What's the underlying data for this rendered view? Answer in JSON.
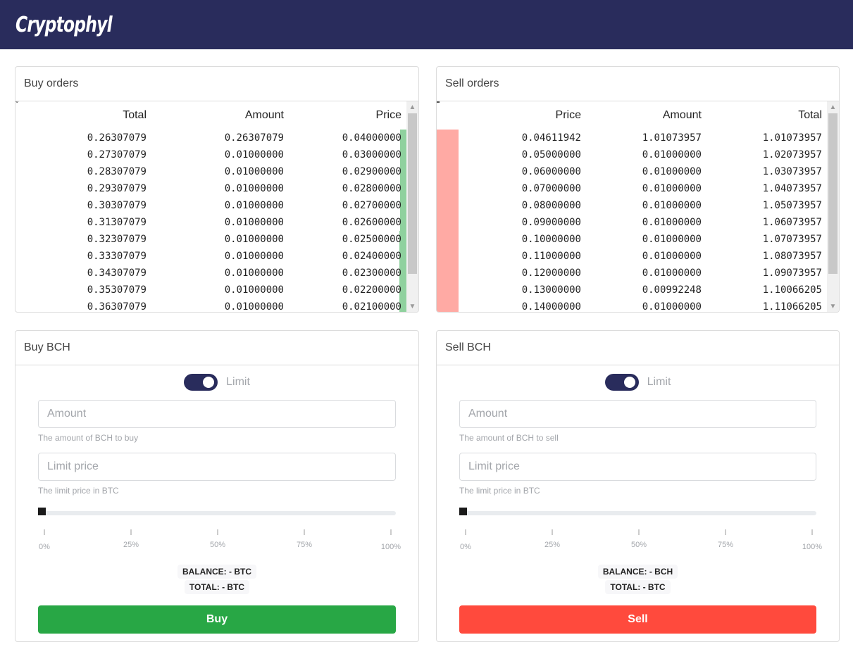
{
  "app": {
    "logo": "Cryptophyl"
  },
  "colors": {
    "header_bg": "#292c5c",
    "buy": "#28a745",
    "sell": "#ff4a3d",
    "buy_depth": "#8fd19e",
    "sell_depth": "#ffaaa4"
  },
  "buy_orders": {
    "title": "Buy orders",
    "columns": [
      "Total",
      "Amount",
      "Price"
    ],
    "rows": [
      {
        "total": "0.26307079",
        "amount": "0.26307079",
        "price": "0.04000000"
      },
      {
        "total": "0.27307079",
        "amount": "0.01000000",
        "price": "0.03000000"
      },
      {
        "total": "0.28307079",
        "amount": "0.01000000",
        "price": "0.02900000"
      },
      {
        "total": "0.29307079",
        "amount": "0.01000000",
        "price": "0.02800000"
      },
      {
        "total": "0.30307079",
        "amount": "0.01000000",
        "price": "0.02700000"
      },
      {
        "total": "0.31307079",
        "amount": "0.01000000",
        "price": "0.02600000"
      },
      {
        "total": "0.32307079",
        "amount": "0.01000000",
        "price": "0.02500000"
      },
      {
        "total": "0.33307079",
        "amount": "0.01000000",
        "price": "0.02400000"
      },
      {
        "total": "0.34307079",
        "amount": "0.01000000",
        "price": "0.02300000"
      },
      {
        "total": "0.35307079",
        "amount": "0.01000000",
        "price": "0.02200000"
      },
      {
        "total": "0.36307079",
        "amount": "0.01000000",
        "price": "0.02100000"
      }
    ]
  },
  "sell_orders": {
    "title": "Sell orders",
    "columns": [
      "Price",
      "Amount",
      "Total"
    ],
    "rows": [
      {
        "price": "0.04611942",
        "amount": "1.01073957",
        "total": "1.01073957"
      },
      {
        "price": "0.05000000",
        "amount": "0.01000000",
        "total": "1.02073957"
      },
      {
        "price": "0.06000000",
        "amount": "0.01000000",
        "total": "1.03073957"
      },
      {
        "price": "0.07000000",
        "amount": "0.01000000",
        "total": "1.04073957"
      },
      {
        "price": "0.08000000",
        "amount": "0.01000000",
        "total": "1.05073957"
      },
      {
        "price": "0.09000000",
        "amount": "0.01000000",
        "total": "1.06073957"
      },
      {
        "price": "0.10000000",
        "amount": "0.01000000",
        "total": "1.07073957"
      },
      {
        "price": "0.11000000",
        "amount": "0.01000000",
        "total": "1.08073957"
      },
      {
        "price": "0.12000000",
        "amount": "0.01000000",
        "total": "1.09073957"
      },
      {
        "price": "0.13000000",
        "amount": "0.00992248",
        "total": "1.10066205"
      },
      {
        "price": "0.14000000",
        "amount": "0.01000000",
        "total": "1.11066205"
      }
    ]
  },
  "buy_form": {
    "title": "Buy BCH",
    "toggle_label": "Limit",
    "toggle_on": true,
    "amount_value": "",
    "amount_placeholder": "Amount",
    "amount_help": "The amount of BCH to buy",
    "price_value": "",
    "price_placeholder": "Limit price",
    "price_help": "The limit price in BTC",
    "slider_percent": 0,
    "slider_marks": [
      "0%",
      "25%",
      "50%",
      "75%",
      "100%"
    ],
    "balance": "BALANCE: - BTC",
    "total": "TOTAL: - BTC",
    "button": "Buy"
  },
  "sell_form": {
    "title": "Sell BCH",
    "toggle_label": "Limit",
    "toggle_on": true,
    "amount_value": "",
    "amount_placeholder": "Amount",
    "amount_help": "The amount of BCH to sell",
    "price_value": "",
    "price_placeholder": "Limit price",
    "price_help": "The limit price in BTC",
    "slider_percent": 0,
    "slider_marks": [
      "0%",
      "25%",
      "50%",
      "75%",
      "100%"
    ],
    "balance": "BALANCE: - BCH",
    "total": "TOTAL: - BTC",
    "button": "Sell"
  }
}
